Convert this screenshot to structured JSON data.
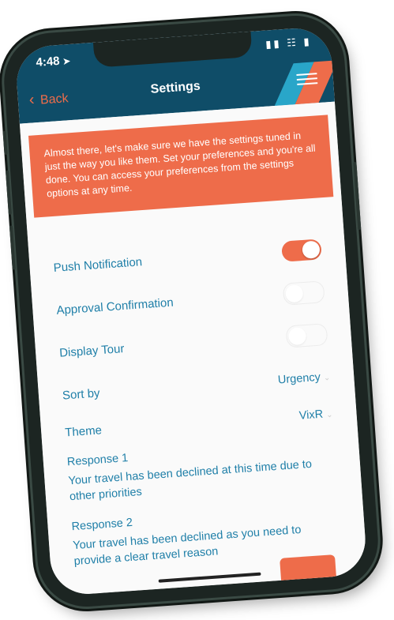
{
  "status_bar": {
    "time": "4:48",
    "location_icon": "location-arrow-icon",
    "icons": [
      "signal-icon",
      "wifi-icon",
      "battery-icon"
    ]
  },
  "nav": {
    "back_label": "Back",
    "title": "Settings",
    "menu_icon": "hamburger-menu-icon"
  },
  "banner": {
    "text": "Almost there, let's make sure we have the settings tuned in just the way you like them. Set your preferences and you're all done. You can access your preferences from the settings options at any time."
  },
  "settings": {
    "push_notification": {
      "label": "Push Notification",
      "enabled": true
    },
    "approval_confirmation": {
      "label": "Approval Confirmation",
      "enabled": false
    },
    "display_tour": {
      "label": "Display Tour",
      "enabled": false
    },
    "sort_by": {
      "label": "Sort by",
      "value": "Urgency"
    },
    "theme": {
      "label": "Theme",
      "value": "VixR"
    }
  },
  "responses": [
    {
      "label": "Response 1",
      "text": "Your travel has been declined at this time due to other priorities"
    },
    {
      "label": "Response 2",
      "text": "Your travel has been declined as you need to provide a clear travel reason"
    }
  ],
  "colors": {
    "header": "#0f4d68",
    "accent": "#ee6c4a",
    "link": "#1f7fa8",
    "stripe_blue": "#29a6c9"
  }
}
